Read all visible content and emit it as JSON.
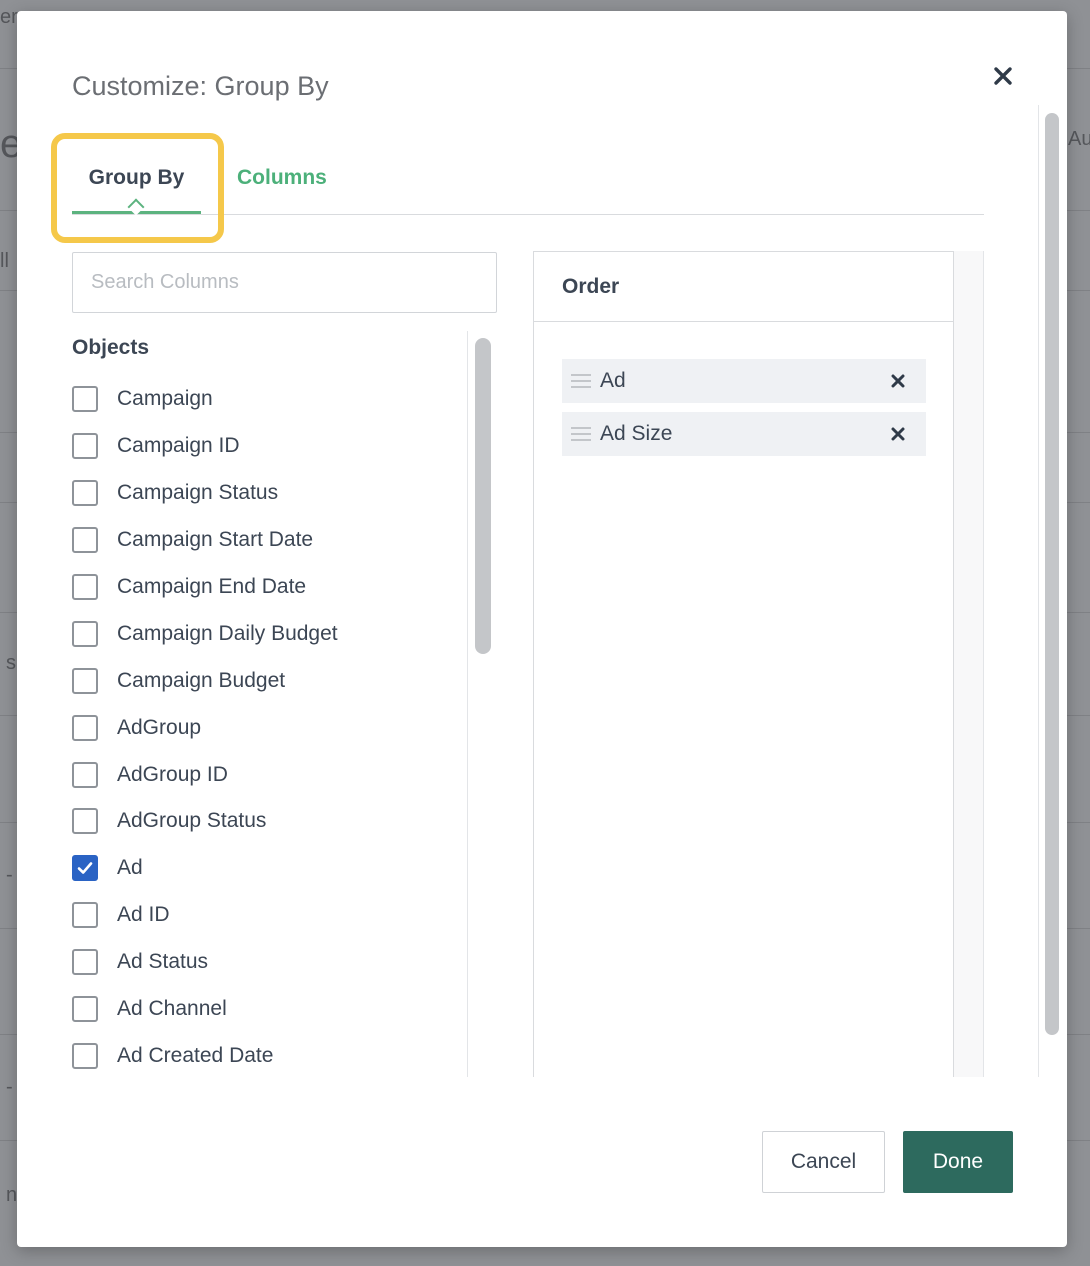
{
  "modal": {
    "title": "Customize: Group By"
  },
  "tabs": [
    {
      "label": "Group By",
      "active": true
    },
    {
      "label": "Columns",
      "active": false
    }
  ],
  "search": {
    "placeholder": "Search Columns",
    "value": ""
  },
  "objects": {
    "heading": "Objects",
    "items": [
      {
        "label": "Campaign",
        "checked": false
      },
      {
        "label": "Campaign ID",
        "checked": false
      },
      {
        "label": "Campaign Status",
        "checked": false
      },
      {
        "label": "Campaign Start Date",
        "checked": false
      },
      {
        "label": "Campaign End Date",
        "checked": false
      },
      {
        "label": "Campaign Daily Budget",
        "checked": false
      },
      {
        "label": "Campaign Budget",
        "checked": false
      },
      {
        "label": "AdGroup",
        "checked": false
      },
      {
        "label": "AdGroup ID",
        "checked": false
      },
      {
        "label": "AdGroup Status",
        "checked": false
      },
      {
        "label": "Ad",
        "checked": true
      },
      {
        "label": "Ad ID",
        "checked": false
      },
      {
        "label": "Ad Status",
        "checked": false
      },
      {
        "label": "Ad Channel",
        "checked": false
      },
      {
        "label": "Ad Created Date",
        "checked": false
      }
    ]
  },
  "order": {
    "heading": "Order",
    "items": [
      {
        "label": "Ad"
      },
      {
        "label": "Ad Size"
      }
    ]
  },
  "footer": {
    "cancel_label": "Cancel",
    "done_label": "Done"
  },
  "colors": {
    "accent_green": "#5cb37f",
    "done_button": "#2d6a5e",
    "checkbox_checked": "#2a63c4",
    "highlight": "#f5c84a"
  },
  "background": {
    "fragments": [
      "er",
      "e",
      "ll",
      "Au",
      "s",
      "-",
      "-",
      "n"
    ]
  }
}
